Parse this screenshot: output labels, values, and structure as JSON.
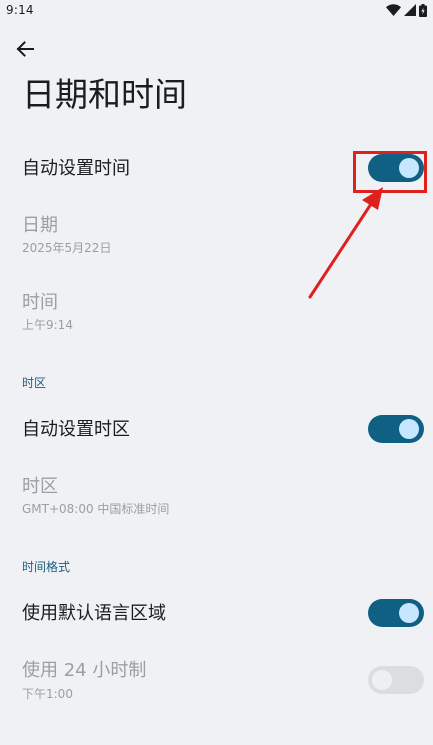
{
  "status_bar": {
    "time": "9:14",
    "icons": [
      "wifi-icon",
      "signal-icon",
      "battery-icon"
    ]
  },
  "header": {
    "back_icon": "arrow-left-icon",
    "title": "日期和时间"
  },
  "settings": {
    "auto_time": {
      "label": "自动设置时间",
      "enabled": true
    },
    "date": {
      "label": "日期",
      "value": "2025年5月22日",
      "disabled": true
    },
    "time": {
      "label": "时间",
      "value": "上午9:14",
      "disabled": true
    }
  },
  "timezone_section": {
    "header": "时区",
    "auto_timezone": {
      "label": "自动设置时区",
      "enabled": true
    },
    "timezone": {
      "label": "时区",
      "value": "GMT+08:00 中国标准时间",
      "disabled": true
    }
  },
  "format_section": {
    "header": "时间格式",
    "use_locale_default": {
      "label": "使用默认语言区域",
      "enabled": true
    },
    "use_24_hour": {
      "label": "使用 24 小时制",
      "value": "下午1:00",
      "enabled": false,
      "disabled": true
    }
  },
  "annotation": {
    "color": "#e0201d",
    "highlight_target": "auto-time-toggle"
  },
  "colors": {
    "background": "#f0f1f4",
    "accent": "#0f6083",
    "thumb_on": "#c6e7ff",
    "section_header": "#1d5c80",
    "disabled_text": "#9c9ea3"
  }
}
